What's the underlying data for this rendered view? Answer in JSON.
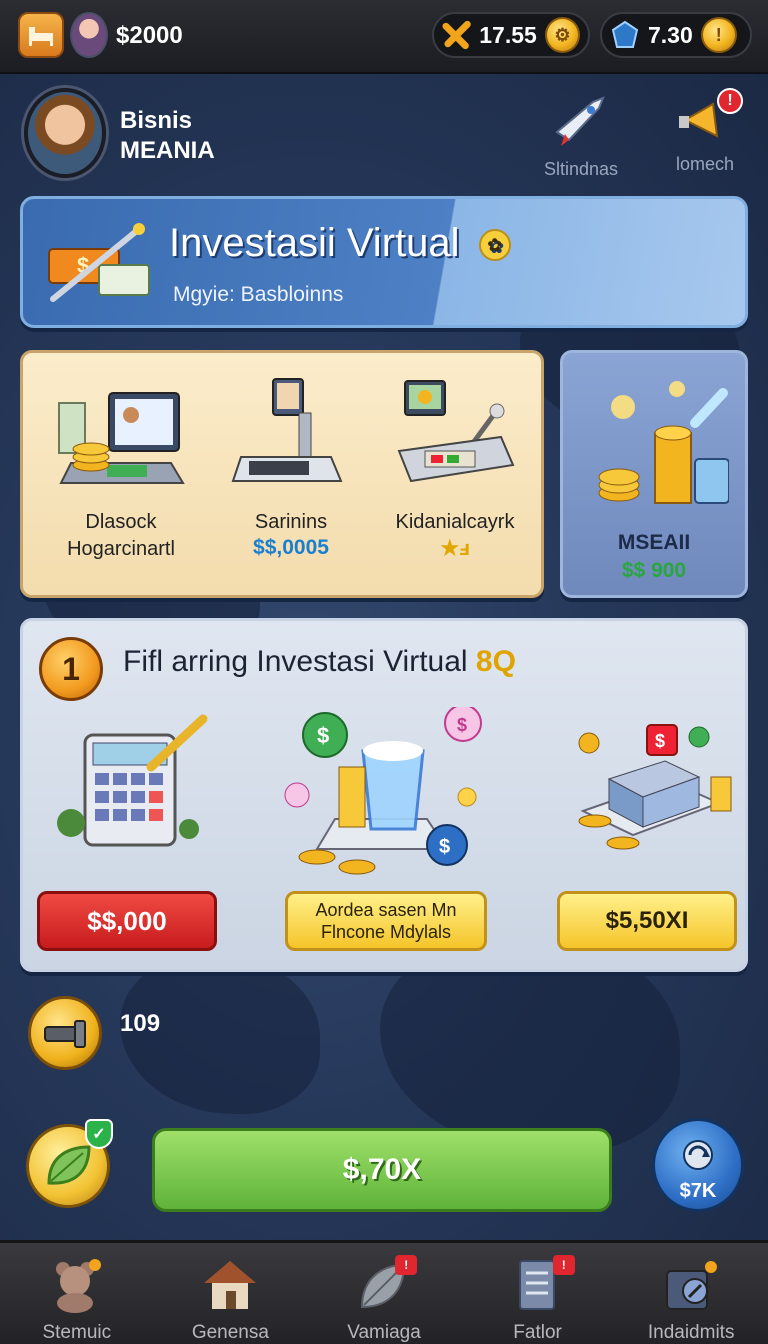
{
  "topbar": {
    "money": "$2000",
    "resource_a": {
      "value": "17.55",
      "icon": "crossed-tools-icon"
    },
    "resource_b": {
      "value": "7.30",
      "icon": "gem-icon"
    }
  },
  "profile": {
    "name_line1": "Bisnis",
    "name_line2": "MEANIA"
  },
  "header_icons": [
    {
      "label": "Sltindnas",
      "icon": "rocket-icon"
    },
    {
      "label": "lomech",
      "icon": "megaphone-icon",
      "badge": "!"
    }
  ],
  "banner": {
    "title": "Investasii Virtual",
    "subtitle": "Mgyie: Basbloinns"
  },
  "store": {
    "items": [
      {
        "name_line1": "Dlasock",
        "name_line2": "Hogarcinartl"
      },
      {
        "name_line1": "Sarinins",
        "price": "$$,0005"
      },
      {
        "name_line1": "Kidanialcayrk",
        "stars": "★ⅎ"
      }
    ],
    "premium": {
      "name": "MSEAII",
      "price": "$$ 900"
    }
  },
  "lessons": {
    "level": "1",
    "title": "Fifl arring Investasi Virtual",
    "title_tag": "8Q",
    "buttons": {
      "left": "$$,000",
      "middle_line1": "Aordea sasen Mn",
      "middle_line2": "Flncone Mdylals",
      "right": "$5,50XI"
    }
  },
  "bottom": {
    "count": "109",
    "main_button": "$,70X",
    "side_button": "$7K"
  },
  "nav": [
    {
      "label": "Stemuic",
      "icon": "teddy-bear-icon"
    },
    {
      "label": "Genensa",
      "icon": "house-icon"
    },
    {
      "label": "Vamiaga",
      "icon": "leaf-icon",
      "badge": "!"
    },
    {
      "label": "Fatlor",
      "icon": "document-icon",
      "badge": "!"
    },
    {
      "label": "Indaidmits",
      "icon": "safe-icon"
    }
  ],
  "colors": {
    "accent_green": "#5fb33a",
    "accent_red": "#c71b1d",
    "accent_yellow": "#f5c52a",
    "accent_blue": "#2e6fc6"
  }
}
